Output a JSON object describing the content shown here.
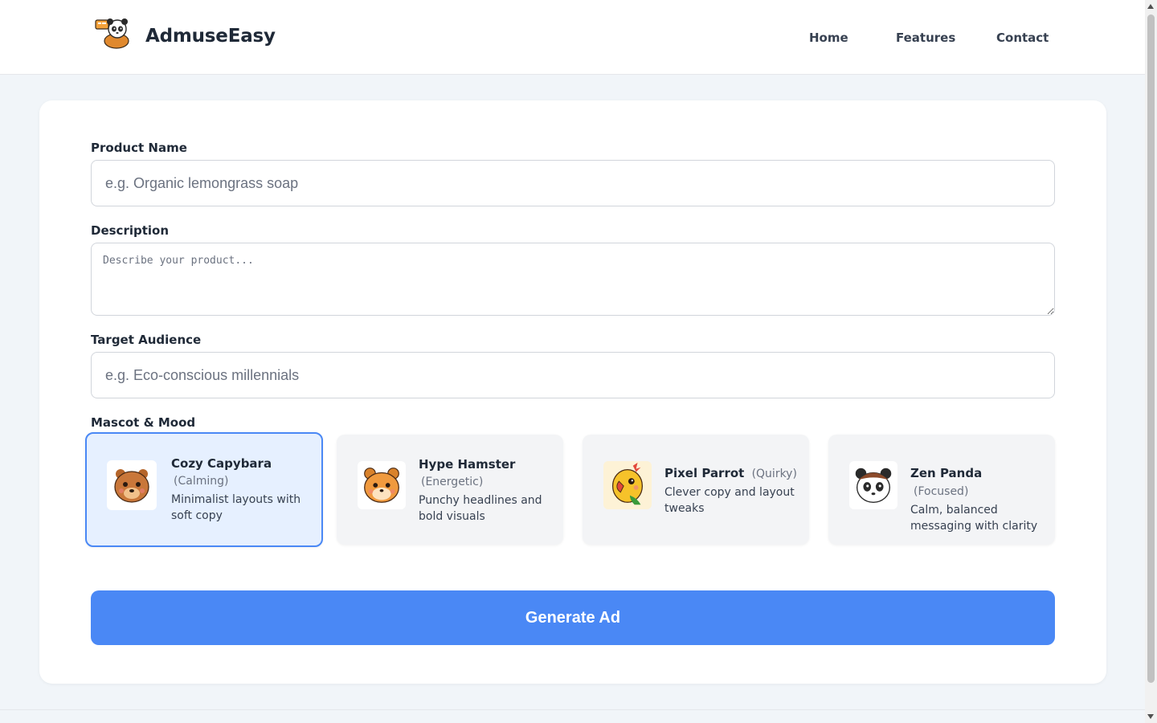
{
  "header": {
    "brand": "AdmuseEasy",
    "logo_icon": "panda-mascot-logo-icon",
    "nav": {
      "home": "Home",
      "features": "Features",
      "contact": "Contact"
    }
  },
  "form": {
    "product_name": {
      "label": "Product Name",
      "placeholder": "e.g. Organic lemongrass soap",
      "value": ""
    },
    "description": {
      "label": "Description",
      "placeholder": "Describe your product...",
      "value": ""
    },
    "target_audience": {
      "label": "Target Audience",
      "placeholder": "e.g. Eco-conscious millennials",
      "value": ""
    },
    "mascot_mood": {
      "label": "Mascot & Mood",
      "selected": "Cozy Capybara",
      "options": [
        {
          "name": "Cozy Capybara",
          "mood": "(Calming)",
          "description": "Minimalist layouts with soft copy",
          "icon": "capybara-icon"
        },
        {
          "name": "Hype Hamster",
          "mood": "(Energetic)",
          "description": "Punchy headlines and bold visuals",
          "icon": "hamster-icon"
        },
        {
          "name": "Pixel Parrot",
          "mood": "(Quirky)",
          "description": "Clever copy and layout tweaks",
          "icon": "parrot-icon"
        },
        {
          "name": "Zen Panda",
          "mood": "(Focused)",
          "description": "Calm, balanced messaging with clarity",
          "icon": "panda-icon"
        }
      ]
    },
    "submit_label": "Generate Ad"
  },
  "colors": {
    "accent": "#4a88f5",
    "selected_card_bg": "#e6f0ff",
    "page_bg": "#f1f5f9"
  }
}
